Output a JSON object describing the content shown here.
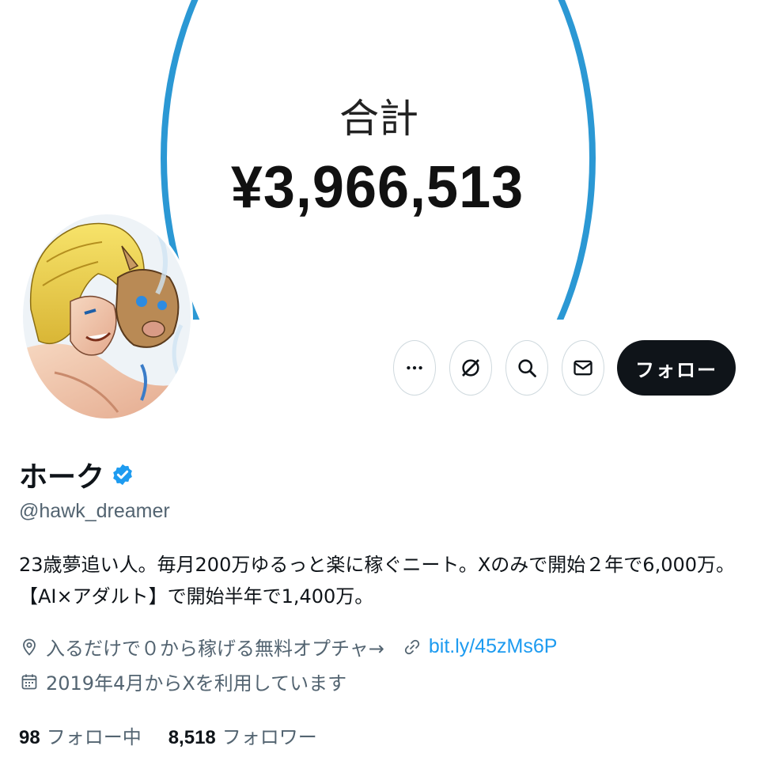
{
  "banner": {
    "label": "合計",
    "amount": "¥3,966,513",
    "ring_color": "#2b98d4"
  },
  "avatar": {
    "icon": "avatar-illustration"
  },
  "actions": {
    "more_icon": "more-icon",
    "grok_icon": "grok-icon",
    "search_icon": "search-icon",
    "message_icon": "mail-icon",
    "follow_label": "フォロー"
  },
  "profile": {
    "display_name": "ホーク",
    "verified_color": "#1d9bf0",
    "handle": "@hawk_dreamer",
    "bio_line1": "23歳夢追い人。毎月200万ゆるっと楽に稼ぐニート。Xのみで開始２年で6,000万。",
    "bio_line2": "【AI×アダルト】で開始半年で1,400万。",
    "location": "入るだけで０から稼げる無料オプチャ→",
    "link": "bit.ly/45zMs6P",
    "joined": "2019年4月からXを利用しています"
  },
  "stats": {
    "following_count": "98",
    "following_label": "フォロー中",
    "followers_count": "8,518",
    "followers_label": "フォロワー"
  },
  "colors": {
    "text_primary": "#0f1419",
    "text_secondary": "#536471",
    "link": "#1d9bf0",
    "button_dark": "#0f1419"
  }
}
